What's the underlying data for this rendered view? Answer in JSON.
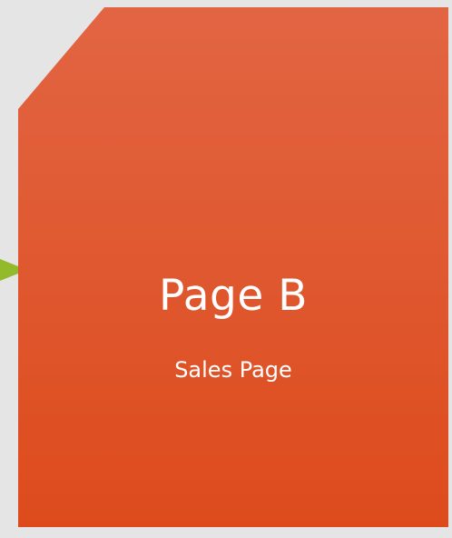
{
  "card": {
    "title": "Page B",
    "subtitle": "Sales Page",
    "color_top": "#e26543",
    "color_bottom": "#dd4b1c"
  },
  "connector": {
    "color": "#93ba2a"
  },
  "background": "#e5e5e5"
}
